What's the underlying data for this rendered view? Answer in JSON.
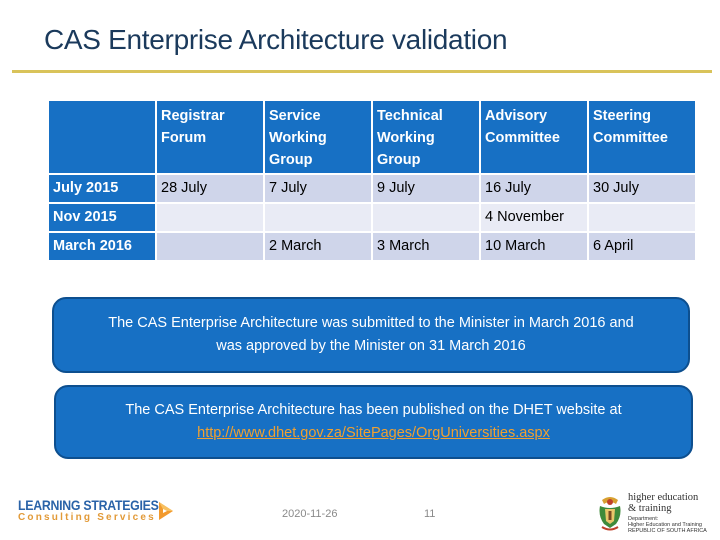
{
  "slide": {
    "title": "CAS Enterprise Architecture validation"
  },
  "schedule": {
    "columns": [
      "",
      "Registrar Forum",
      "Service Working Group",
      "Technical Working Group",
      "Advisory Committee",
      "Steering Committee"
    ],
    "rows": [
      {
        "period": "July 2015",
        "cells": [
          "28 July",
          "7 July",
          "9 July",
          "16 July",
          "30 July"
        ]
      },
      {
        "period": "Nov 2015",
        "cells": [
          "",
          "",
          "",
          "4 November",
          ""
        ]
      },
      {
        "period": "March 2016",
        "cells": [
          "",
          "2 March",
          "3 March",
          "10 March",
          "6 April"
        ]
      }
    ]
  },
  "callouts": {
    "submitted": {
      "line1": "The CAS Enterprise Architecture was submitted to the Minister in March 2016 and",
      "line2": "was approved by the Minister on 31 March 2016"
    },
    "published": {
      "line1": "The CAS Enterprise Architecture has been published on the DHET website at",
      "link": "http://www.dhet.gov.za/SitePages/OrgUniversities.aspx"
    }
  },
  "footer": {
    "date": "2020-11-26",
    "page": "11",
    "left_logo": {
      "line1": "LEARNING STRATEGIES",
      "line2": "Consulting Services"
    },
    "right_logo": {
      "line1": "higher education",
      "line2": "& training",
      "line3": "Department:",
      "line4": "Higher Education and Training",
      "line5": "REPUBLIC OF SOUTH AFRICA"
    }
  },
  "colors": {
    "accent_blue": "#1770c4",
    "rule_gold": "#d9c35a",
    "row_odd": "#cfd5ea",
    "row_even": "#e9ebf5",
    "link_orange": "#f0a030"
  }
}
